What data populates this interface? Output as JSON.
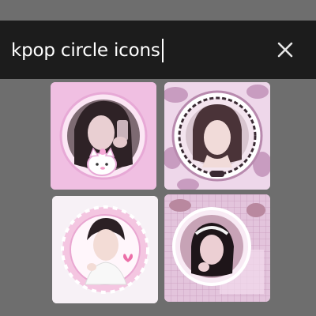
{
  "search": {
    "query": "kpop circle icons"
  },
  "results": [
    {
      "name": "result-1"
    },
    {
      "name": "result-2"
    },
    {
      "name": "result-3"
    },
    {
      "name": "result-4"
    }
  ],
  "icons": {
    "clear": "close-icon"
  },
  "colors": {
    "search_bg": "#1c1c1c",
    "page_bg": "#6e6e6e",
    "pink": "#f0bfe2",
    "mauve": "#dfb9d6"
  }
}
